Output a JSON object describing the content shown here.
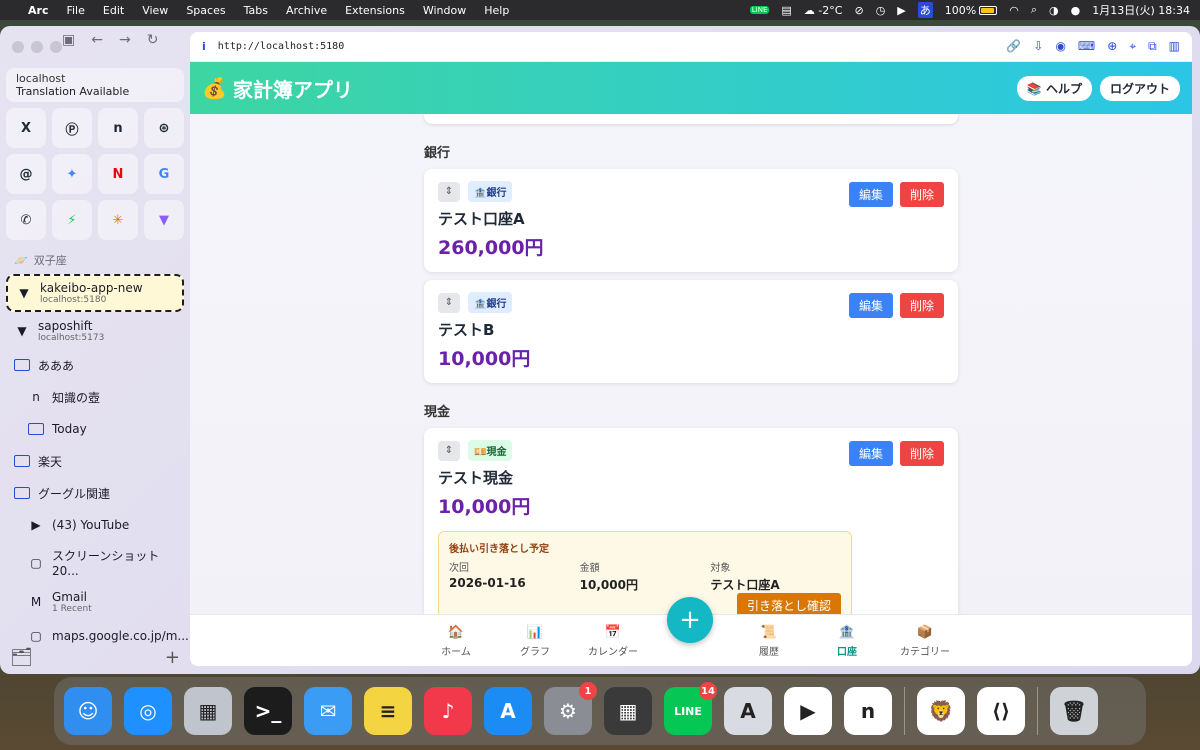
{
  "menubar": {
    "app": "Arc",
    "menus": [
      "File",
      "Edit",
      "View",
      "Spaces",
      "Tabs",
      "Archive",
      "Extensions",
      "Window",
      "Help"
    ],
    "temperature": "-2°C",
    "input_method": "あ",
    "battery": "100%",
    "datetime": "1月13日(火) 18:34"
  },
  "sidebar": {
    "translation_host": "localhost",
    "translation_text": "Translation Available",
    "favorites": [
      "X",
      "Ⓟ",
      "n",
      "⊛",
      "@",
      "✦",
      "N",
      "G",
      "✆",
      "⚡",
      "✳",
      "▼"
    ],
    "space_label": "双子座",
    "items": [
      {
        "label": "kakeibo-app-new",
        "sub": "localhost:5180",
        "icon": "▼",
        "type": "tab",
        "active": true
      },
      {
        "label": "saposhift",
        "sub": "localhost:5173",
        "icon": "▼",
        "type": "tab"
      },
      {
        "label": "あああ",
        "type": "folder"
      },
      {
        "label": "知識の壺",
        "icon": "n",
        "type": "tab",
        "indent": true
      },
      {
        "label": "Today",
        "type": "folder",
        "indent": true
      },
      {
        "label": "楽天",
        "type": "folder"
      },
      {
        "label": "グーグル関連",
        "type": "folder"
      },
      {
        "label": "(43) YouTube",
        "icon": "▶",
        "type": "tab",
        "indent": true
      },
      {
        "label": "スクリーンショット 20...",
        "icon": "▢",
        "type": "tab",
        "indent": true
      },
      {
        "label": "Gmail",
        "sub": "1 Recent",
        "icon": "M",
        "type": "tab",
        "indent": true
      },
      {
        "label": "maps.google.co.jp/m...",
        "icon": "▢",
        "type": "tab",
        "indent": true
      }
    ]
  },
  "browser": {
    "url": "http://localhost:5180"
  },
  "app": {
    "title": "家計簿アプリ",
    "title_icon": "💰",
    "help_label": "ヘルプ",
    "help_icon": "📚",
    "logout_label": "ログアウト",
    "sections": {
      "bank": "銀行",
      "cash": "現金"
    },
    "accounts": [
      {
        "type_label": "銀行",
        "type_icon": "🏦",
        "name": "テスト口座A",
        "balance": "260,000円",
        "edit": "編集",
        "delete": "削除"
      },
      {
        "type_label": "銀行",
        "type_icon": "🏦",
        "name": "テストB",
        "balance": "10,000円",
        "edit": "編集",
        "delete": "削除"
      },
      {
        "type_label": "現金",
        "type_icon": "💴",
        "name": "テスト現金",
        "balance": "10,000円",
        "edit": "編集",
        "delete": "削除"
      }
    ],
    "debit": {
      "title": "後払い引き落とし予定",
      "next_label": "次回",
      "next_value": "2026-01-16",
      "amount_label": "金額",
      "amount_value": "10,000円",
      "target_label": "対象",
      "target_value": "テスト口座A",
      "confirm_label": "引き落とし確認"
    },
    "nav": [
      {
        "label": "ホーム",
        "icon": "🏠"
      },
      {
        "label": "グラフ",
        "icon": "📊"
      },
      {
        "label": "カレンダー",
        "icon": "📅"
      },
      {
        "label": "履歴",
        "icon": "📜"
      },
      {
        "label": "口座",
        "icon": "🏦",
        "active": true
      },
      {
        "label": "カテゴリー",
        "icon": "📦"
      }
    ],
    "fab": "+"
  },
  "dock": {
    "apps": [
      {
        "name": "finder",
        "color": "#2f8ef0",
        "glyph": "☺"
      },
      {
        "name": "safari",
        "color": "#1e90ff",
        "glyph": "◎"
      },
      {
        "name": "launchpad",
        "color": "#c0c4cc",
        "glyph": "▦"
      },
      {
        "name": "terminal",
        "color": "#1c1c1c",
        "glyph": ">_"
      },
      {
        "name": "mail",
        "color": "#3b9cf5",
        "glyph": "✉"
      },
      {
        "name": "notes",
        "color": "#f5d442",
        "glyph": "≡"
      },
      {
        "name": "music",
        "color": "#f2384b",
        "glyph": "♪"
      },
      {
        "name": "app-store",
        "color": "#1c8cf5",
        "glyph": "A"
      },
      {
        "name": "system-settings",
        "color": "#8a8d93",
        "glyph": "⚙",
        "badge": "1"
      },
      {
        "name": "calculator",
        "color": "#3a3a3a",
        "glyph": "▦"
      },
      {
        "name": "line",
        "color": "#06c755",
        "glyph": "LINE",
        "badge": "14"
      },
      {
        "name": "affinity",
        "color": "#d9dbe2",
        "glyph": "A"
      },
      {
        "name": "youtube",
        "color": "#ffffff",
        "glyph": "▶"
      },
      {
        "name": "notion",
        "color": "#ffffff",
        "glyph": "n"
      },
      {
        "name": "brave",
        "color": "#ffffff",
        "glyph": "🦁"
      },
      {
        "name": "vscode",
        "color": "#ffffff",
        "glyph": "⟨⟩"
      },
      {
        "name": "trash",
        "color": "#cfd2d6",
        "glyph": "🗑"
      }
    ]
  }
}
